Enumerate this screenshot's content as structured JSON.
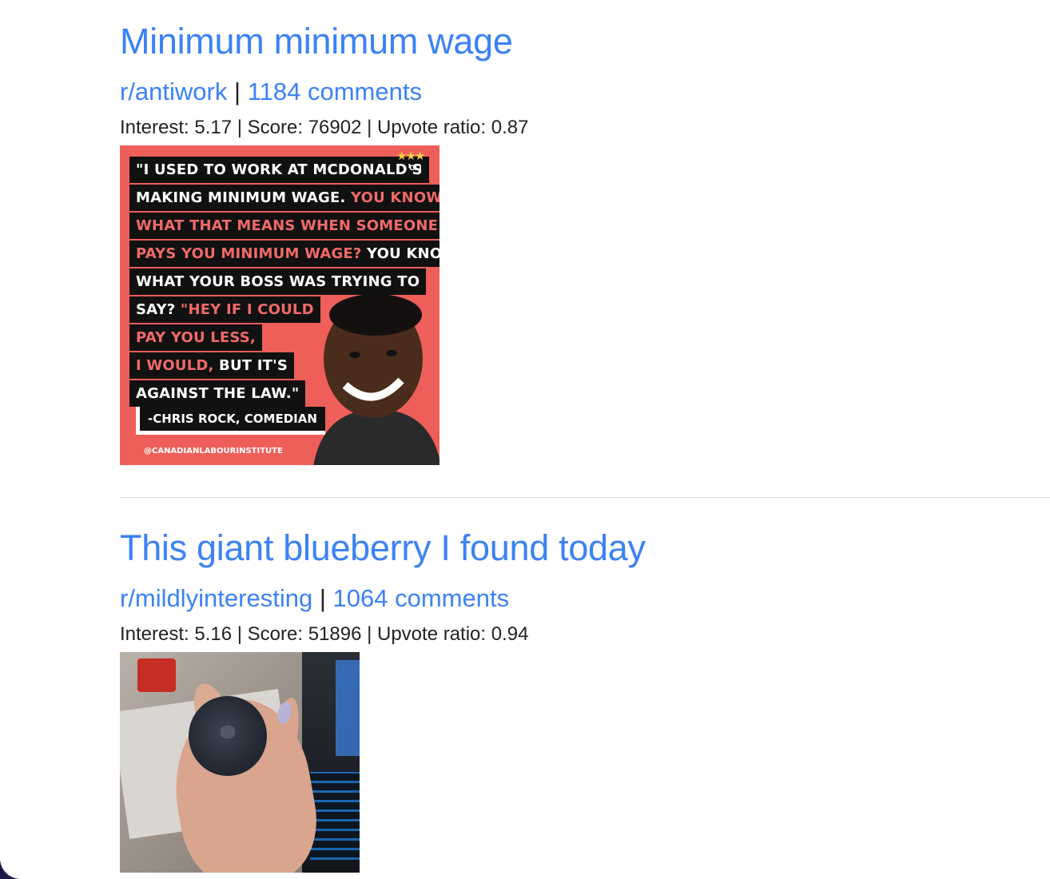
{
  "posts": [
    {
      "title": "Minimum minimum wage",
      "subreddit": "r/antiwork",
      "separator": "|",
      "comments": "1184 comments",
      "meta": "Interest: 5.17 | Score: 76902 | Upvote ratio: 0.87",
      "image": {
        "quote_lines": [
          {
            "a": "\"I USED TO WORK AT MCDONALD'S",
            "b": ""
          },
          {
            "a": "MAKING MINIMUM WAGE. ",
            "b": "YOU KNOW"
          },
          {
            "a": "",
            "b": "WHAT THAT MEANS WHEN SOMEONE"
          },
          {
            "a": "",
            "b": "PAYS YOU MINIMUM WAGE?",
            "c": " YOU KNOW"
          },
          {
            "a": "WHAT YOUR BOSS WAS TRYING TO",
            "b": ""
          },
          {
            "a": "SAY? ",
            "b": "\"HEY IF I COULD"
          },
          {
            "a": "",
            "b": "PAY YOU LESS,"
          },
          {
            "a": "",
            "b": "I WOULD,",
            "c": " BUT IT'S"
          },
          {
            "a": "AGAINST THE LAW.\"",
            "b": ""
          }
        ],
        "attribution": "-CHRIS ROCK, COMEDIAN",
        "handle": "@CANADIANLABOURINSTITUTE",
        "logo_text": "CLI",
        "stars": "★★★",
        "accent_color": "#ee5f5a"
      }
    },
    {
      "title": "This giant blueberry I found today",
      "subreddit": "r/mildlyinteresting",
      "separator": "|",
      "comments": "1064 comments",
      "meta": "Interest: 5.16 | Score: 51896 | Upvote ratio: 0.94"
    }
  ],
  "colors": {
    "link": "#3b82f6",
    "text": "#222222",
    "divider": "#dcdcdc"
  }
}
